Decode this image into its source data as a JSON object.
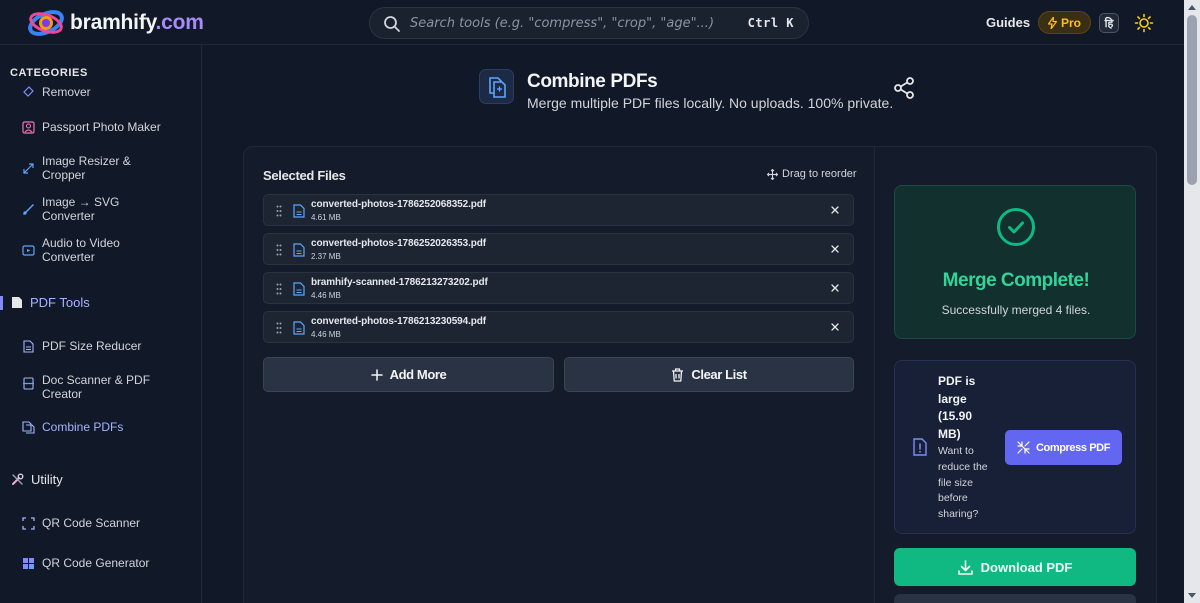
{
  "header": {
    "logo_text": "bramhify",
    "logo_suffix": ".com",
    "search_placeholder": "Search tools (e.g. \"compress\", \"crop\", \"age\"...)",
    "search_shortcut": "Ctrl K",
    "guides_label": "Guides",
    "pro_label": "Pro",
    "lang_label": "हि"
  },
  "sidebar": {
    "categories_label": "CATEGORIES",
    "image_items": [
      {
        "label": "Remover",
        "icon": "eraser-icon"
      },
      {
        "label": "Passport Photo Maker",
        "icon": "portrait-icon"
      },
      {
        "label": "Image Resizer & Cropper",
        "icon": "resize-icon"
      },
      {
        "label": "Image → SVG Converter",
        "icon": "vector-icon"
      },
      {
        "label": "Audio to Video Converter",
        "icon": "video-icon"
      }
    ],
    "pdf_section": "PDF Tools",
    "pdf_items": [
      {
        "label": "PDF Size Reducer",
        "icon": "file-shrink-icon"
      },
      {
        "label": "Doc Scanner & PDF Creator",
        "icon": "scanner-icon"
      },
      {
        "label": "Combine PDFs",
        "icon": "combine-icon"
      }
    ],
    "utility_section": "Utility",
    "utility_items": [
      {
        "label": "QR Code Scanner",
        "icon": "qr-scan-icon"
      },
      {
        "label": "QR Code Generator",
        "icon": "qr-grid-icon"
      }
    ]
  },
  "hero": {
    "title": "Combine PDFs",
    "subtitle": "Merge multiple PDF files locally. No uploads. 100% private."
  },
  "files": {
    "title": "Selected Files",
    "drag_hint": "Drag to reorder",
    "items": [
      {
        "name": "converted-photos-1786252068352.pdf",
        "size": "4.61 MB"
      },
      {
        "name": "converted-photos-1786252026353.pdf",
        "size": "2.37 MB"
      },
      {
        "name": "bramhify-scanned-1786213273202.pdf",
        "size": "4.46 MB"
      },
      {
        "name": "converted-photos-1786213230594.pdf",
        "size": "4.46 MB"
      }
    ],
    "add_more": "Add More",
    "clear_list": "Clear List"
  },
  "result": {
    "title": "Merge Complete!",
    "subtitle": "Successfully merged 4 files.",
    "warn_title": "PDF is large (15.90 MB)",
    "warn_desc": "Want to reduce the file size before sharing?",
    "compress_label": "Compress PDF",
    "download_label": "Download PDF"
  },
  "colors": {
    "accent": "#6366f1",
    "success": "#10b981",
    "success_text": "#34d399",
    "pro": "#fbbf24"
  }
}
